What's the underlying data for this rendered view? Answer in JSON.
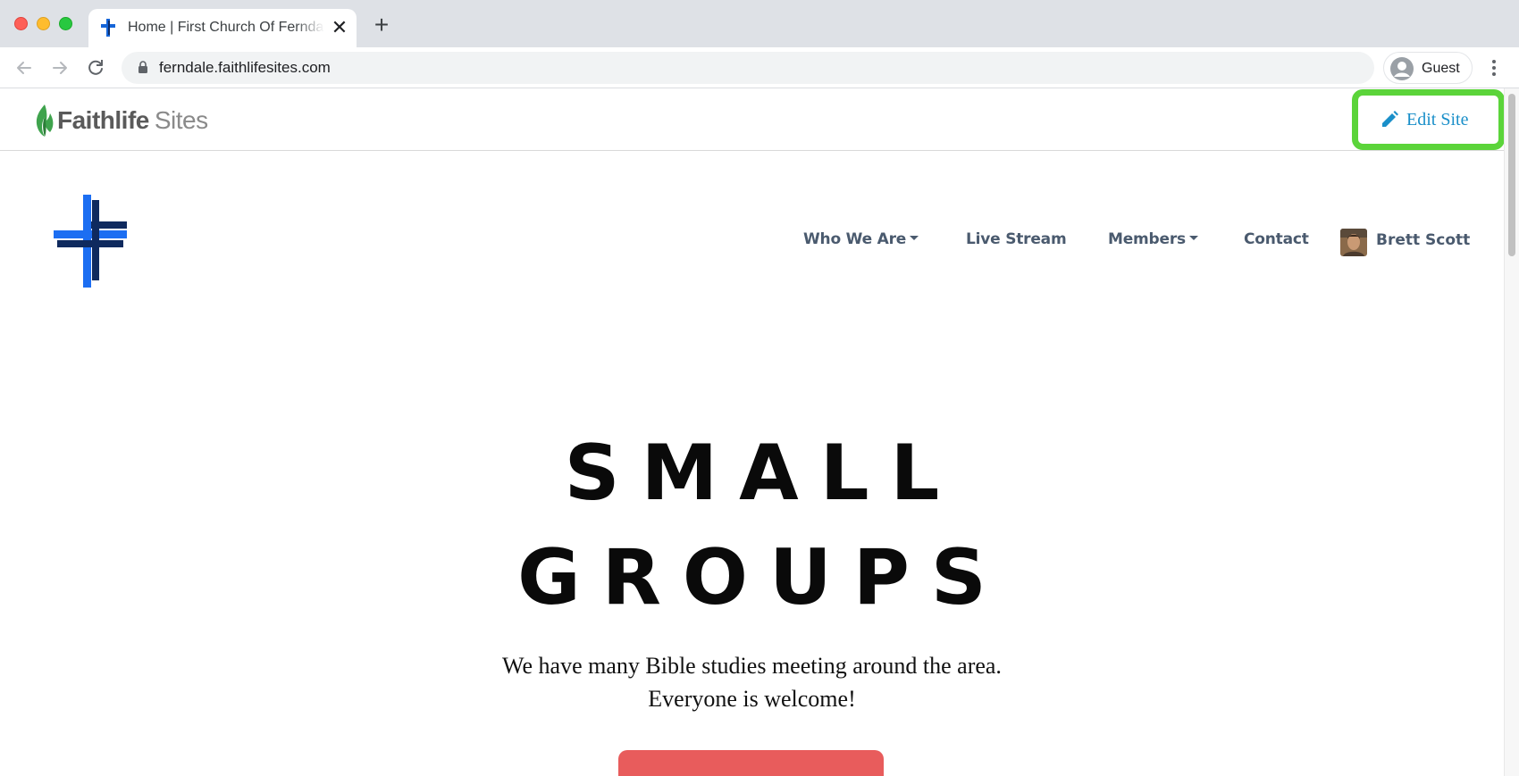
{
  "browser": {
    "tab": {
      "title": "Home | First Church Of Ferndale",
      "close_glyph": "✕"
    },
    "new_tab_glyph": "+",
    "url": "ferndale.faithlifesites.com",
    "profile_label": "Guest",
    "icons": [
      "back-arrow-icon",
      "forward-arrow-icon",
      "reload-icon",
      "lock-icon",
      "profile-icon",
      "kebab-menu-icon"
    ]
  },
  "admin_bar": {
    "logo_bold": "Faithlife",
    "logo_light": "Sites",
    "edit_label": "Edit Site",
    "highlight_color": "#5bd43a"
  },
  "site": {
    "nav": {
      "who_we_are": "Who We Are",
      "live_stream": "Live Stream",
      "members": "Members",
      "contact": "Contact",
      "user_name": "Brett Scott"
    },
    "hero": {
      "line1": "SMALL",
      "line2": "GROUPS",
      "subtitle1": "We have many Bible studies meeting around the area.",
      "subtitle2": "Everyone is welcome!"
    },
    "colors": {
      "nav_text": "#4a5a6e",
      "cta": "#e85c5c",
      "link_blue": "#1a8fc9"
    }
  }
}
